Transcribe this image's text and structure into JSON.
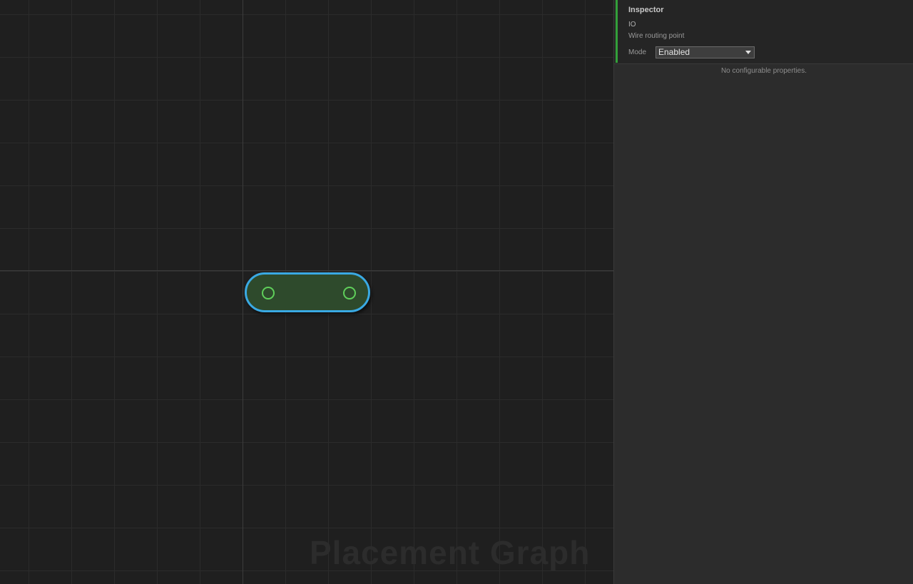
{
  "canvas": {
    "watermark": "Placement Graph"
  },
  "node": {
    "input_port_icon": "circle-port-icon",
    "output_port_icon": "circle-port-icon"
  },
  "inspector": {
    "title": "Inspector",
    "node_type": "IO",
    "node_description": "Wire routing point",
    "mode_label": "Mode",
    "mode_value": "Enabled",
    "empty_message": "No configurable properties."
  },
  "colors": {
    "canvas_bg": "#1f1f1f",
    "node_fill": "#2e4a2c",
    "node_selected_border": "#3aa9e3",
    "port_color": "#5fcf5a",
    "accent": "#33a03a"
  }
}
